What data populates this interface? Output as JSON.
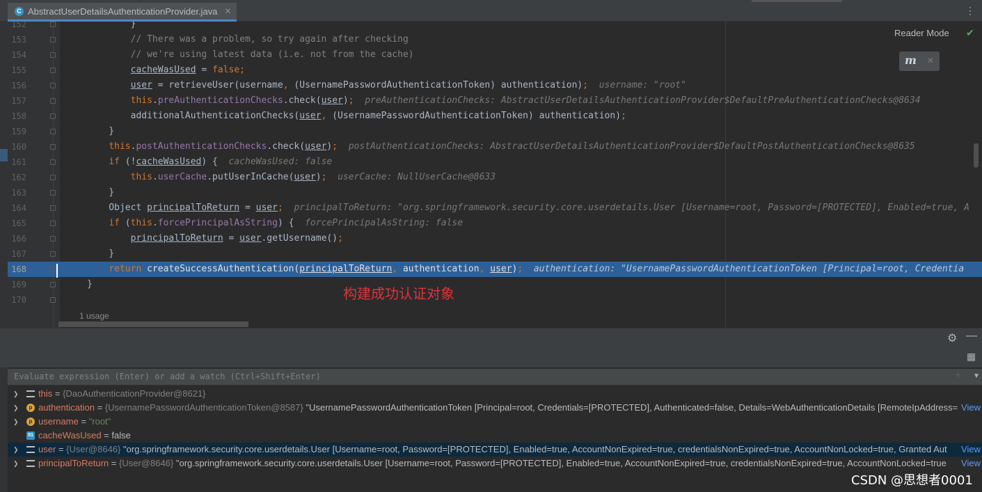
{
  "tab": {
    "icon_name": "java-class-icon",
    "icon_letter": "C",
    "file_name": "AbstractUserDetailsAuthenticationProvider.java",
    "close_icon": "close-icon"
  },
  "editor": {
    "reader_mode": "Reader Mode",
    "reader_icon_letter": "m",
    "usage_hint": "1 usage",
    "annotation": "构建成功认证对象",
    "current_line": 168,
    "lines": [
      {
        "num": "152",
        "code": "        }"
      },
      {
        "num": "153",
        "code": "        // There was a problem, so try again after checking"
      },
      {
        "num": "154",
        "code": "        // we're using latest data (i.e. not from the cache)"
      },
      {
        "num": "155",
        "code": "        cacheWasUsed = false;"
      },
      {
        "num": "156",
        "code": "        user = retrieveUser(username, (UsernamePasswordAuthenticationToken) authentication);",
        "hint": "username: \"root\""
      },
      {
        "num": "157",
        "code": "        this.preAuthenticationChecks.check(user);",
        "hint": "preAuthenticationChecks: AbstractUserDetailsAuthenticationProvider$DefaultPreAuthenticationChecks@8634"
      },
      {
        "num": "158",
        "code": "        additionalAuthenticationChecks(user, (UsernamePasswordAuthenticationToken) authentication);"
      },
      {
        "num": "159",
        "code": "    }"
      },
      {
        "num": "160",
        "code": "    this.postAuthenticationChecks.check(user);",
        "hint": "postAuthenticationChecks: AbstractUserDetailsAuthenticationProvider$DefaultPostAuthenticationChecks@8635"
      },
      {
        "num": "161",
        "code": "    if (!cacheWasUsed) {",
        "hint": "cacheWasUsed: false"
      },
      {
        "num": "162",
        "code": "        this.userCache.putUserInCache(user);",
        "hint": "userCache: NullUserCache@8633"
      },
      {
        "num": "163",
        "code": "    }"
      },
      {
        "num": "164",
        "code": "    Object principalToReturn = user;",
        "hint": "principalToReturn: \"org.springframework.security.core.userdetails.User [Username=root, Password=[PROTECTED], Enabled=true, A"
      },
      {
        "num": "165",
        "code": "    if (this.forcePrincipalAsString) {",
        "hint": "forcePrincipalAsString: false"
      },
      {
        "num": "166",
        "code": "        principalToReturn = user.getUsername();"
      },
      {
        "num": "167",
        "code": "    }"
      },
      {
        "num": "168",
        "code": "    return createSuccessAuthentication(principalToReturn, authentication, user);",
        "hint": "authentication: \"UsernamePasswordAuthenticationToken [Principal=root, Credentia"
      },
      {
        "num": "169",
        "code": "}"
      },
      {
        "num": "170",
        "code": ""
      }
    ]
  },
  "debugger": {
    "evaluate_placeholder": "Evaluate expression (Enter) or add a watch (Ctrl+Shift+Enter)",
    "view_label": "View",
    "variables": [
      {
        "name": "this",
        "type": "{DaoAuthenticationProvider@8621}",
        "value": "",
        "icon": "lines",
        "expandable": true
      },
      {
        "name": "authentication",
        "type": "{UsernamePasswordAuthenticationToken@8587}",
        "value": "\"UsernamePasswordAuthenticationToken [Principal=root, Credentials=[PROTECTED], Authenticated=false, Details=WebAuthenticationDetails [RemoteIpAddress=",
        "icon": "p",
        "expandable": true,
        "view": true
      },
      {
        "name": "username",
        "type": "",
        "value": "\"root\"",
        "icon": "p",
        "expandable": true,
        "string": true
      },
      {
        "name": "cacheWasUsed",
        "type": "",
        "value": "false",
        "icon": "primitive",
        "expandable": false
      },
      {
        "name": "user",
        "type": "{User@8646}",
        "value": "\"org.springframework.security.core.userdetails.User [Username=root, Password=[PROTECTED], Enabled=true, AccountNonExpired=true, credentialsNonExpired=true, AccountNonLocked=true, Granted Aut",
        "icon": "lines",
        "expandable": true,
        "selected": true,
        "view": true
      },
      {
        "name": "principalToReturn",
        "type": "{User@8646}",
        "value": "\"org.springframework.security.core.userdetails.User [Username=root, Password=[PROTECTED], Enabled=true, AccountNonExpired=true, credentialsNonExpired=true, AccountNonLocked=true",
        "icon": "lines",
        "expandable": true,
        "view": true
      }
    ]
  },
  "watermark": "CSDN @思想者0001",
  "colors": {
    "selection": "#2d6099",
    "keyword": "#cc7832",
    "field": "#9876aa",
    "comment": "#808080",
    "annotation": "#e0323b",
    "link": "#589df6"
  }
}
